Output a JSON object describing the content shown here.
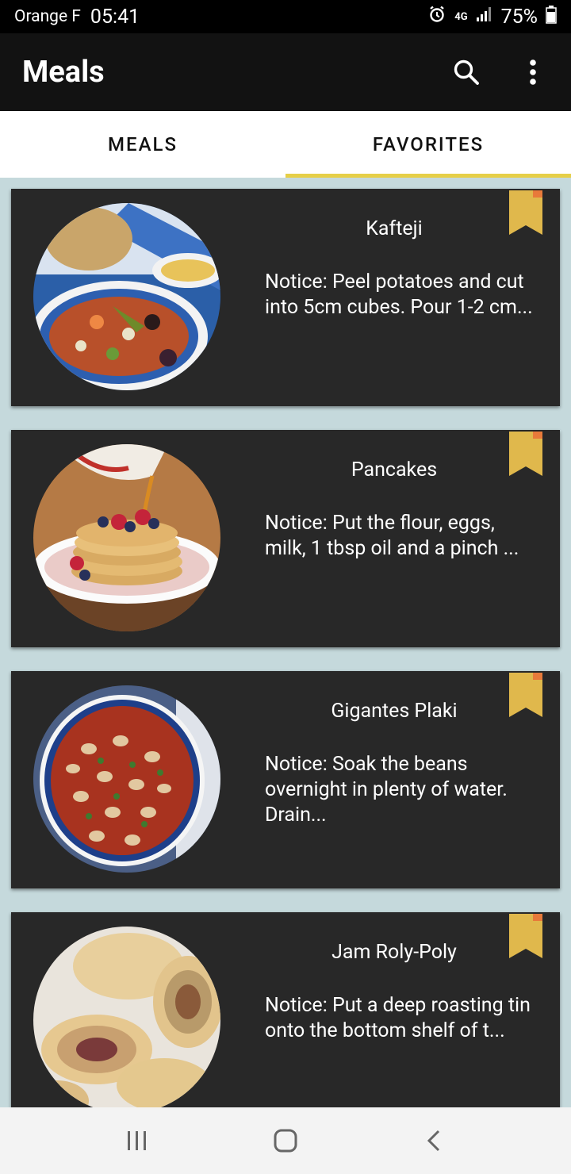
{
  "status_bar": {
    "carrier": "Orange F",
    "time": "05:41",
    "network": "4G",
    "battery": "75%"
  },
  "app_bar": {
    "title": "Meals",
    "search_icon": "search-icon",
    "more_icon": "more-vert-icon"
  },
  "tabs": [
    {
      "label": "MEALS",
      "active": false
    },
    {
      "label": "FAVORITES",
      "active": true
    }
  ],
  "meals": [
    {
      "name": "Kafteji",
      "notice": "Notice: Peel potatoes and cut into 5cm cubes. Pour 1-2 cm..."
    },
    {
      "name": "Pancakes",
      "notice": "Notice: Put the flour, eggs, milk, 1 tbsp oil and a pinch ..."
    },
    {
      "name": "Gigantes Plaki",
      "notice": "Notice: Soak the beans overnight in plenty of water. Drain..."
    },
    {
      "name": "Jam Roly-Poly",
      "notice": "Notice: Put a deep roasting tin onto the bottom shelf of t..."
    }
  ],
  "colors": {
    "accent": "#e6cf48",
    "bookmark": "#e0b84c",
    "bookmark_corner": "#e87a3a",
    "card_bg": "#282828",
    "list_bg": "#c5d9dc"
  },
  "nav_bar": {
    "recents_icon": "recents-icon",
    "home_icon": "home-icon",
    "back_icon": "back-icon"
  }
}
